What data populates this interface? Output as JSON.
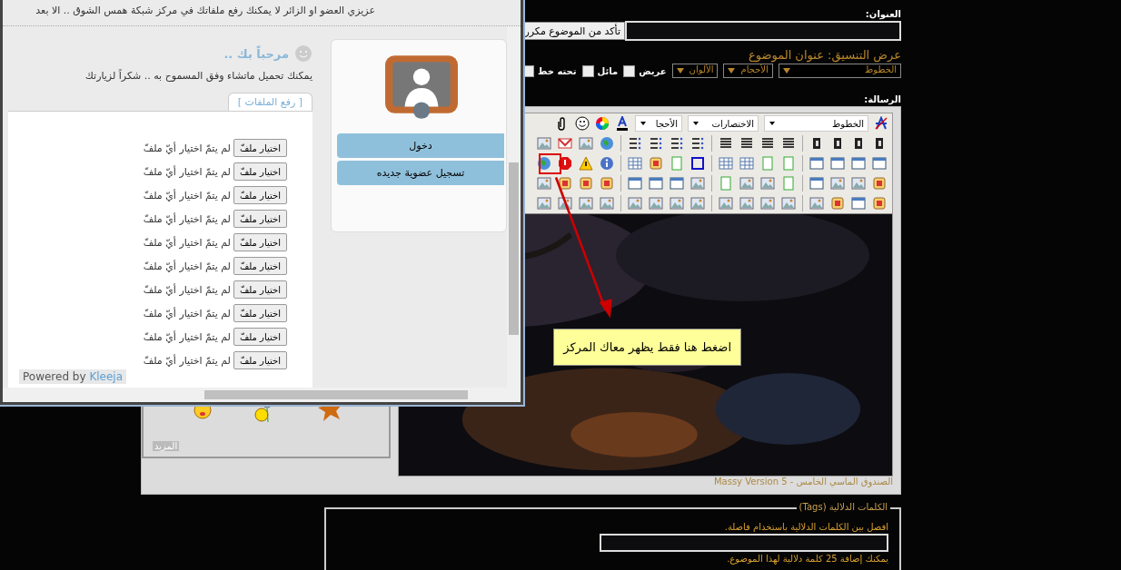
{
  "popup": {
    "notice": "عزيزي العضو او الزائر لا يمكنك رفع ملفاتك في مركز شبكة همس الشوق .. الا بعد",
    "login_buttons": [
      "دخول",
      "تسجيل عضوية جديده"
    ],
    "welcome_title": "مرحباً بك ..",
    "welcome_text": "يمكنك تحميل ماتشاء وفق المسموح به .. شكراً لزيارتك",
    "tabs": [
      {
        "label": "[ رفع الملفات ]",
        "selected": true
      }
    ],
    "file_inputs": [
      {
        "button": "اختيار ملفّ",
        "status": "لم يتمّ اختيار أيّ ملفّ"
      },
      {
        "button": "اختيار ملفّ",
        "status": "لم يتمّ اختيار أيّ ملفّ"
      },
      {
        "button": "اختيار ملفّ",
        "status": "لم يتمّ اختيار أيّ ملفّ"
      },
      {
        "button": "اختيار ملفّ",
        "status": "لم يتمّ اختيار أيّ ملفّ"
      },
      {
        "button": "اختيار ملفّ",
        "status": "لم يتمّ اختيار أيّ ملفّ"
      },
      {
        "button": "اختيار ملفّ",
        "status": "لم يتمّ اختيار أيّ ملفّ"
      },
      {
        "button": "اختيار ملفّ",
        "status": "لم يتمّ اختيار أيّ ملفّ"
      },
      {
        "button": "اختيار ملفّ",
        "status": "لم يتمّ اختيار أيّ ملفّ"
      },
      {
        "button": "اختيار ملفّ",
        "status": "لم يتمّ اختيار أيّ ملفّ"
      },
      {
        "button": "اختيار ملفّ",
        "status": "لم يتمّ اختيار أيّ ملفّ"
      }
    ],
    "powered_by": {
      "text": "Powered by",
      "link": "Kleeja"
    }
  },
  "form": {
    "title_label": "العنوان:",
    "duplicate_button": "تأكد من الموضوع مكرر",
    "preview": "عرض التنسيق: عنوان الموضوع",
    "selects": [
      "الخطوط",
      "الأحجام",
      "الألوان"
    ],
    "checkboxes": [
      {
        "label": "عريض",
        "checked": false
      },
      {
        "label": "مائل",
        "checked": false
      },
      {
        "label": "تحته خط",
        "checked": false
      }
    ],
    "message_label": "الرسالة:",
    "editor_selects": [
      "الخطوط",
      "الاختصارات",
      "الأحجا"
    ],
    "callout": "اضغط هنا فقط يظهر معاك المركز",
    "more_link": "المزيد",
    "footer": "الصندوق الماسي الخامس - Massy Version 5"
  },
  "tags": {
    "legend": "الكلمات الدلالية (Tags)",
    "hint": "افصل بين الكلمات الدلالية باستخدام فاصلة.",
    "limit": "يمكنك إضافة 25 كلمة دلالية لهذا الموضوع."
  }
}
